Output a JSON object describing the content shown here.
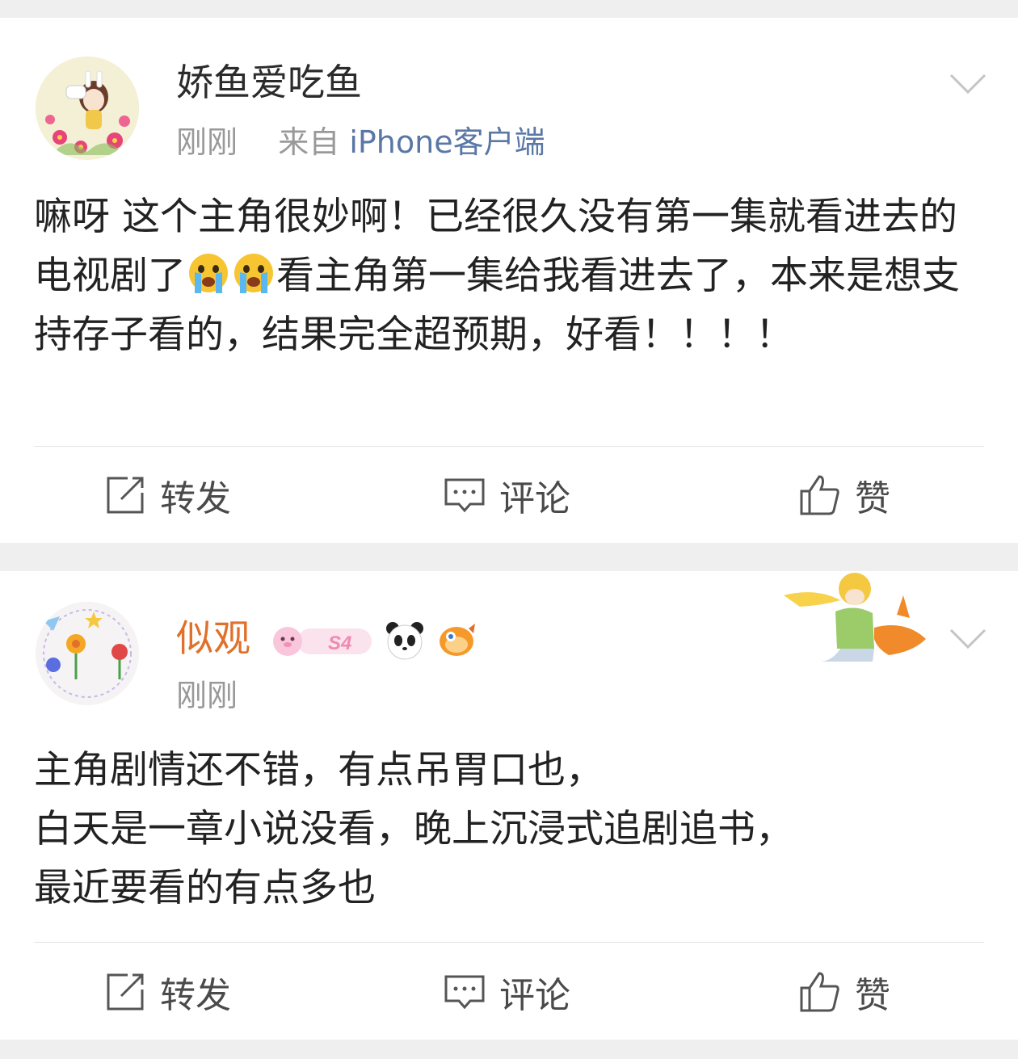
{
  "posts": [
    {
      "username": "娇鱼爱吃鱼",
      "time": "刚刚",
      "source_prefix": "来自",
      "source": "iPhone客户端",
      "avatar_icon": "cartoon-girl-flowers-avatar",
      "text_parts": [
        "嘛呀 这个主角很妙啊！已经很久没有第一集就看进去的电视剧了",
        "看主角第一集给我看进去了，本来是想支持存子看的，结果完全超预期，好看！！！！"
      ],
      "emoji": "crying-face-emoji",
      "actions": {
        "repost": "转发",
        "comment": "评论",
        "like": "赞"
      }
    },
    {
      "username": "似观",
      "time": "刚刚",
      "avatar_icon": "flowers-and-romance-avatar",
      "badges": [
        "S4",
        "panda-emoji",
        "fish-emoji"
      ],
      "decoration": "little-prince-decoration",
      "text_lines": [
        "主角剧情还不错，有点吊胃口也，",
        "白天是一章小说没看，晚上沉浸式追剧追书，",
        "最近要看的有点多也"
      ],
      "actions": {
        "repost": "转发",
        "comment": "评论",
        "like": "赞"
      }
    }
  ],
  "colors": {
    "username_highlight": "#e0702a",
    "source_link": "#5a77a6",
    "meta": "#999999"
  }
}
